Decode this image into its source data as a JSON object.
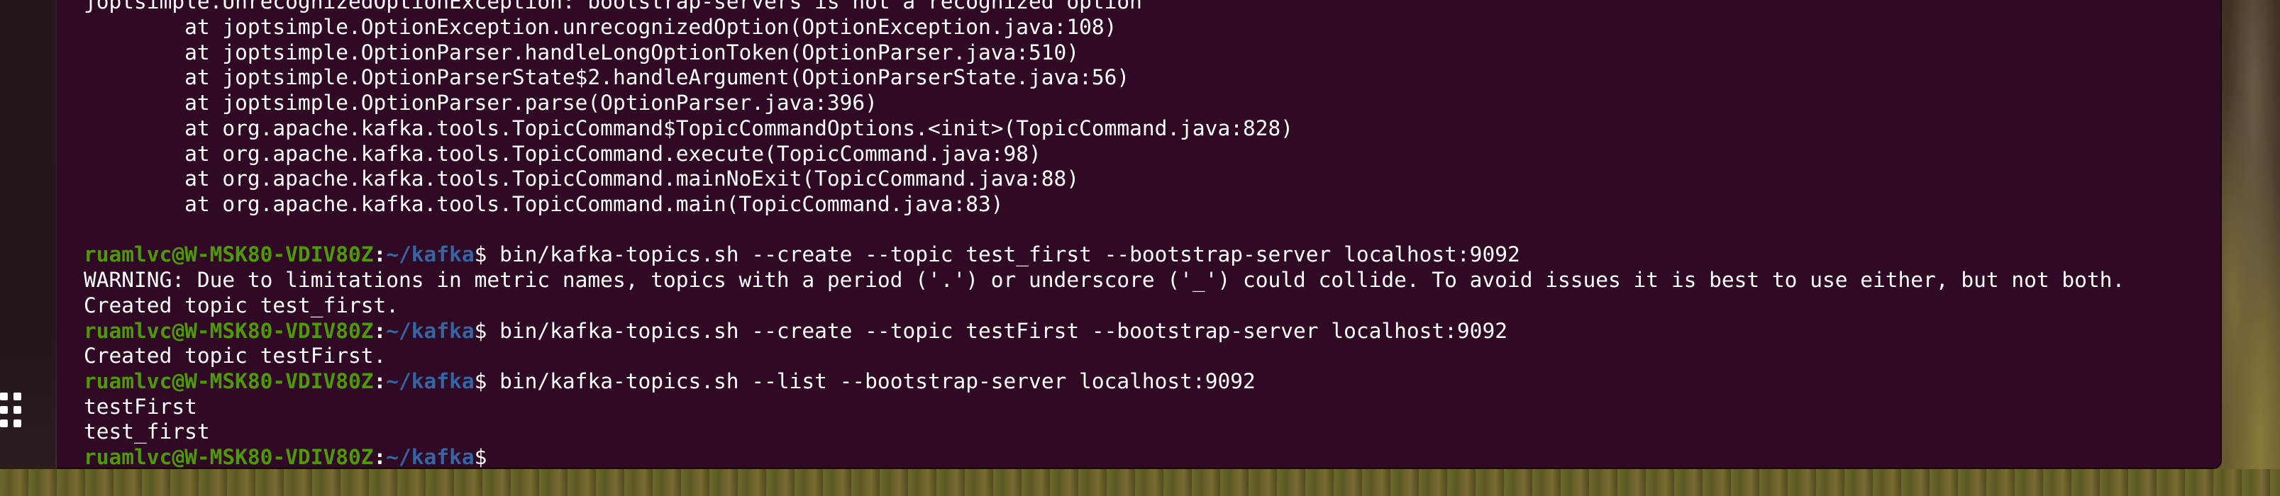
{
  "colors": {
    "terminal_bg": "#300a24",
    "prompt_user": "#4e9a06",
    "prompt_path": "#3465a4",
    "text": "#ffffff"
  },
  "dock": {
    "show_apps_icon": "apps-grid-icon"
  },
  "terminal": {
    "trace_lines": [
      "joptsimple.UnrecognizedOptionException: bootstrap-servers is not a recognized option",
      "        at joptsimple.OptionException.unrecognizedOption(OptionException.java:108)",
      "        at joptsimple.OptionParser.handleLongOptionToken(OptionParser.java:510)",
      "        at joptsimple.OptionParserState$2.handleArgument(OptionParserState.java:56)",
      "        at joptsimple.OptionParser.parse(OptionParser.java:396)",
      "        at org.apache.kafka.tools.TopicCommand$TopicCommandOptions.<init>(TopicCommand.java:828)",
      "        at org.apache.kafka.tools.TopicCommand.execute(TopicCommand.java:98)",
      "        at org.apache.kafka.tools.TopicCommand.mainNoExit(TopicCommand.java:88)",
      "        at org.apache.kafka.tools.TopicCommand.main(TopicCommand.java:83)"
    ],
    "prompt": {
      "user_host": "ruamlvc@W-MSK80-VDIV80Z",
      "separator": ":",
      "path": "~/kafka",
      "symbol": "$"
    },
    "cmd1": " bin/kafka-topics.sh --create --topic test_first --bootstrap-server localhost:9092",
    "warning": "WARNING: Due to limitations in metric names, topics with a period ('.') or underscore ('_') could collide. To avoid issues it is best to use either, but not both.",
    "created1": "Created topic test_first.",
    "cmd2": " bin/kafka-topics.sh --create --topic testFirst --bootstrap-server localhost:9092",
    "created2": "Created topic testFirst.",
    "cmd3": " bin/kafka-topics.sh --list --bootstrap-server localhost:9092",
    "list_output": [
      "testFirst",
      "test_first"
    ],
    "cmd4": ""
  }
}
